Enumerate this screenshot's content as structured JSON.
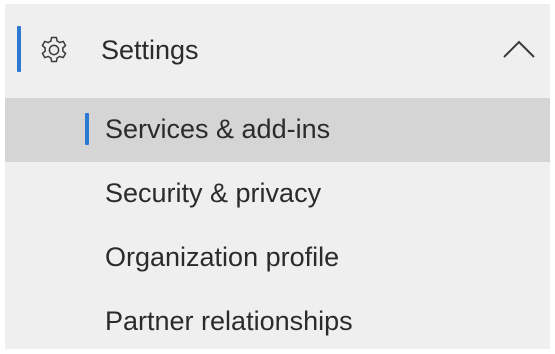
{
  "settings_group": {
    "label": "Settings",
    "icon": "gear-icon",
    "expanded": true,
    "collapse_icon": "chevron-up-icon",
    "accent_color": "#2b79d0"
  },
  "items": [
    {
      "label": "Services & add-ins",
      "selected": true
    },
    {
      "label": "Security & privacy",
      "selected": false
    },
    {
      "label": "Organization profile",
      "selected": false
    },
    {
      "label": "Partner relationships",
      "selected": false
    }
  ],
  "colors": {
    "panel_background": "#efefef",
    "selected_background": "#d5d5d5",
    "accent": "#2b79d0",
    "text": "#2b2b2b"
  }
}
